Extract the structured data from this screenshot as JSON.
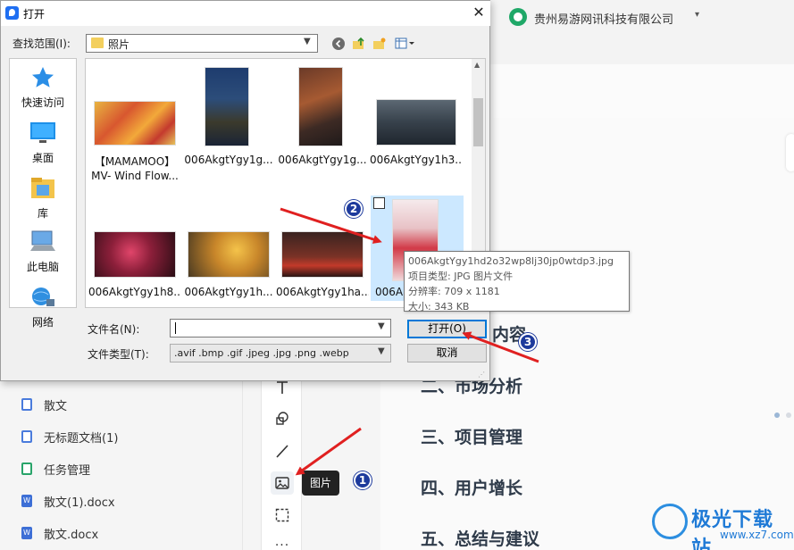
{
  "app": {
    "company": "贵州易游网讯科技有限公司",
    "caret": "▾",
    "docs": [
      {
        "label": "散文",
        "icon": "doc-icon"
      },
      {
        "label": "无标题文档(1)",
        "icon": "doc-icon"
      },
      {
        "label": "任务管理",
        "icon": "sheet-icon"
      },
      {
        "label": "散文(1).docx",
        "icon": "word-icon"
      },
      {
        "label": "散文.docx",
        "icon": "word-icon"
      }
    ],
    "tooltip": "图片",
    "headings": {
      "h1_suffix": "内容",
      "h2": "二、市场分析",
      "h3": "三、项目管理",
      "h4": "四、用户增长",
      "h5": "五、总结与建议"
    }
  },
  "dialog": {
    "title": "打开",
    "close": "✕",
    "lookin_label": "查找范围(I):",
    "lookin_value": "照片",
    "places": [
      {
        "label": "快速访问",
        "icon": "star-icon"
      },
      {
        "label": "桌面",
        "icon": "desktop-icon"
      },
      {
        "label": "库",
        "icon": "library-icon"
      },
      {
        "label": "此电脑",
        "icon": "computer-icon"
      },
      {
        "label": "网络",
        "icon": "network-icon"
      }
    ],
    "files": [
      {
        "name": "【MAMAMOO】",
        "name2": "MV- Wind Flow..."
      },
      {
        "name": "006AkgtYgy1g..."
      },
      {
        "name": "006AkgtYgy1g..."
      },
      {
        "name": "006AkgtYgy1h3..."
      },
      {
        "name": "006AkgtYgy1h8..."
      },
      {
        "name": "006AkgtYgy1h..."
      },
      {
        "name": "006AkgtYgy1ha..."
      },
      {
        "name": "006Ak"
      }
    ],
    "file_tooltip": {
      "filename": "006AkgtYgy1hd2o32wp8lj30jp0wtdp3.jpg",
      "type": "项目类型: JPG 图片文件",
      "resolution": "分辨率: 709 x 1181",
      "size": "大小: 343 KB"
    },
    "filename_label": "文件名(N):",
    "filename_value": "",
    "filetype_label": "文件类型(T):",
    "filetype_value": ".avif .bmp .gif .jpeg .jpg .png .webp",
    "open_label": "打开(O)",
    "cancel_label": "取消"
  },
  "badges": [
    "1",
    "2",
    "3"
  ],
  "watermark": {
    "text": "极光下载站",
    "url": "www.xz7.com"
  },
  "colors": {
    "accent": "#0078d7",
    "annotation": "#e02020",
    "badge": "#1d3a9c"
  }
}
